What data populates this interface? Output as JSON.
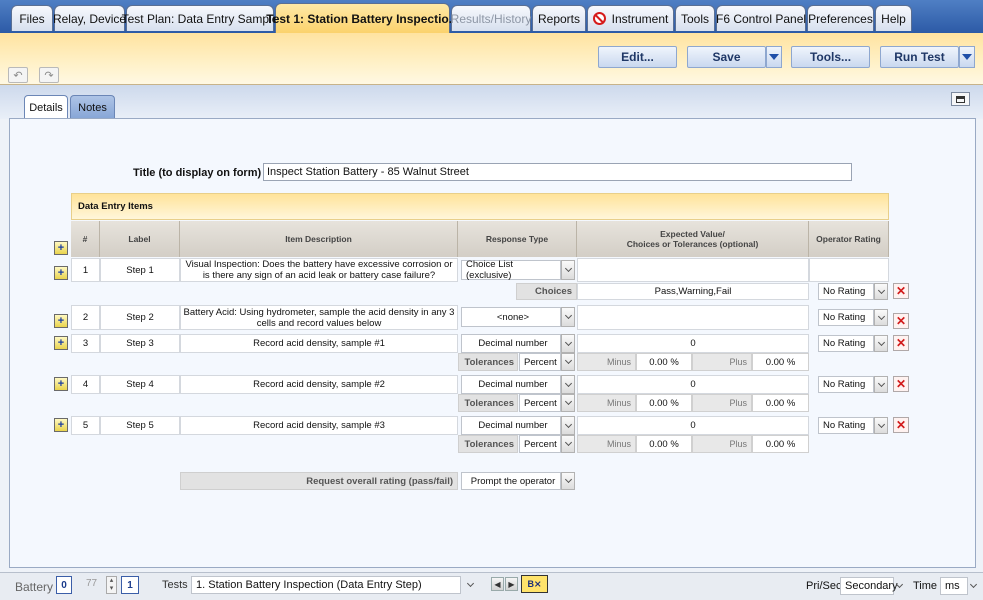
{
  "top_tabs": [
    {
      "label": "Files"
    },
    {
      "label": "Relay, Device"
    },
    {
      "label": "Test Plan: Data Entry Sample"
    },
    {
      "label": "Test 1:  Station Battery Inspectio..."
    },
    {
      "label": "Results/History"
    },
    {
      "label": "Reports"
    },
    {
      "label": "Instrument"
    },
    {
      "label": "Tools"
    },
    {
      "label": "F6 Control Panel"
    },
    {
      "label": "Preferences"
    },
    {
      "label": "Help"
    }
  ],
  "toolbar": {
    "edit": "Edit...",
    "save": "Save",
    "tools": "Tools...",
    "run_test": "Run Test"
  },
  "subtabs": {
    "details": "Details",
    "notes": "Notes"
  },
  "title_field": {
    "label": "Title (to display on form)",
    "value": "Inspect Station Battery - 85 Walnut Street"
  },
  "section_title": "Data Entry Items",
  "headers": {
    "num": "#",
    "label": "Label",
    "desc": "Item Description",
    "resp": "Response Type",
    "exp1": "Expected Value/",
    "exp2": "Choices or Tolerances (optional)",
    "rating": "Operator Rating"
  },
  "rows": [
    {
      "num": "1",
      "label": "Step 1",
      "desc": "Visual Inspection: Does the battery have excessive corrosion or is there any sign of an acid leak or battery case failure?",
      "resp": "Choice List (exclusive)",
      "sub_label": "Choices",
      "sub_value": "Pass,Warning,Fail",
      "rating": "No Rating"
    },
    {
      "num": "2",
      "label": "Step 2",
      "desc": "Battery Acid:  Using hydrometer, sample the acid density in any 3 cells and record values below",
      "resp": "<none>",
      "rating": "No Rating"
    },
    {
      "num": "3",
      "label": "Step 3",
      "desc": "Record acid density, sample #1",
      "resp": "Decimal number",
      "expected": "0",
      "rating": "No Rating",
      "tol_label": "Tolerances",
      "tol_type": "Percent",
      "minus_label": "Minus",
      "minus_value": "0.00 %",
      "plus_label": "Plus",
      "plus_value": "0.00 %"
    },
    {
      "num": "4",
      "label": "Step 4",
      "desc": "Record acid density, sample #2",
      "resp": "Decimal number",
      "expected": "0",
      "rating": "No Rating",
      "tol_label": "Tolerances",
      "tol_type": "Percent",
      "minus_label": "Minus",
      "minus_value": "0.00 %",
      "plus_label": "Plus",
      "plus_value": "0.00 %"
    },
    {
      "num": "5",
      "label": "Step 5",
      "desc": "Record acid density, sample #3",
      "resp": "Decimal number",
      "expected": "0",
      "rating": "No Rating",
      "tol_label": "Tolerances",
      "tol_type": "Percent",
      "minus_label": "Minus",
      "minus_value": "0.00 %",
      "plus_label": "Plus",
      "plus_value": "0.00 %"
    }
  ],
  "overall": {
    "label": "Request overall rating (pass/fail)",
    "value": "Prompt the operator"
  },
  "status": {
    "battery_label": "Battery",
    "battery_value": "0",
    "count": "77",
    "index": "1",
    "tests_label": "Tests",
    "tests_value": "1. Station Battery Inspection (Data Entry Step)",
    "prisec_label": "Pri/Sec",
    "prisec_value": "Secondary",
    "time_label": "Time",
    "time_value": "ms"
  },
  "colors": {
    "active_tab": "#fbd26c",
    "accent_blue": "#2c5aa6",
    "delete_red": "#d11a1a"
  }
}
